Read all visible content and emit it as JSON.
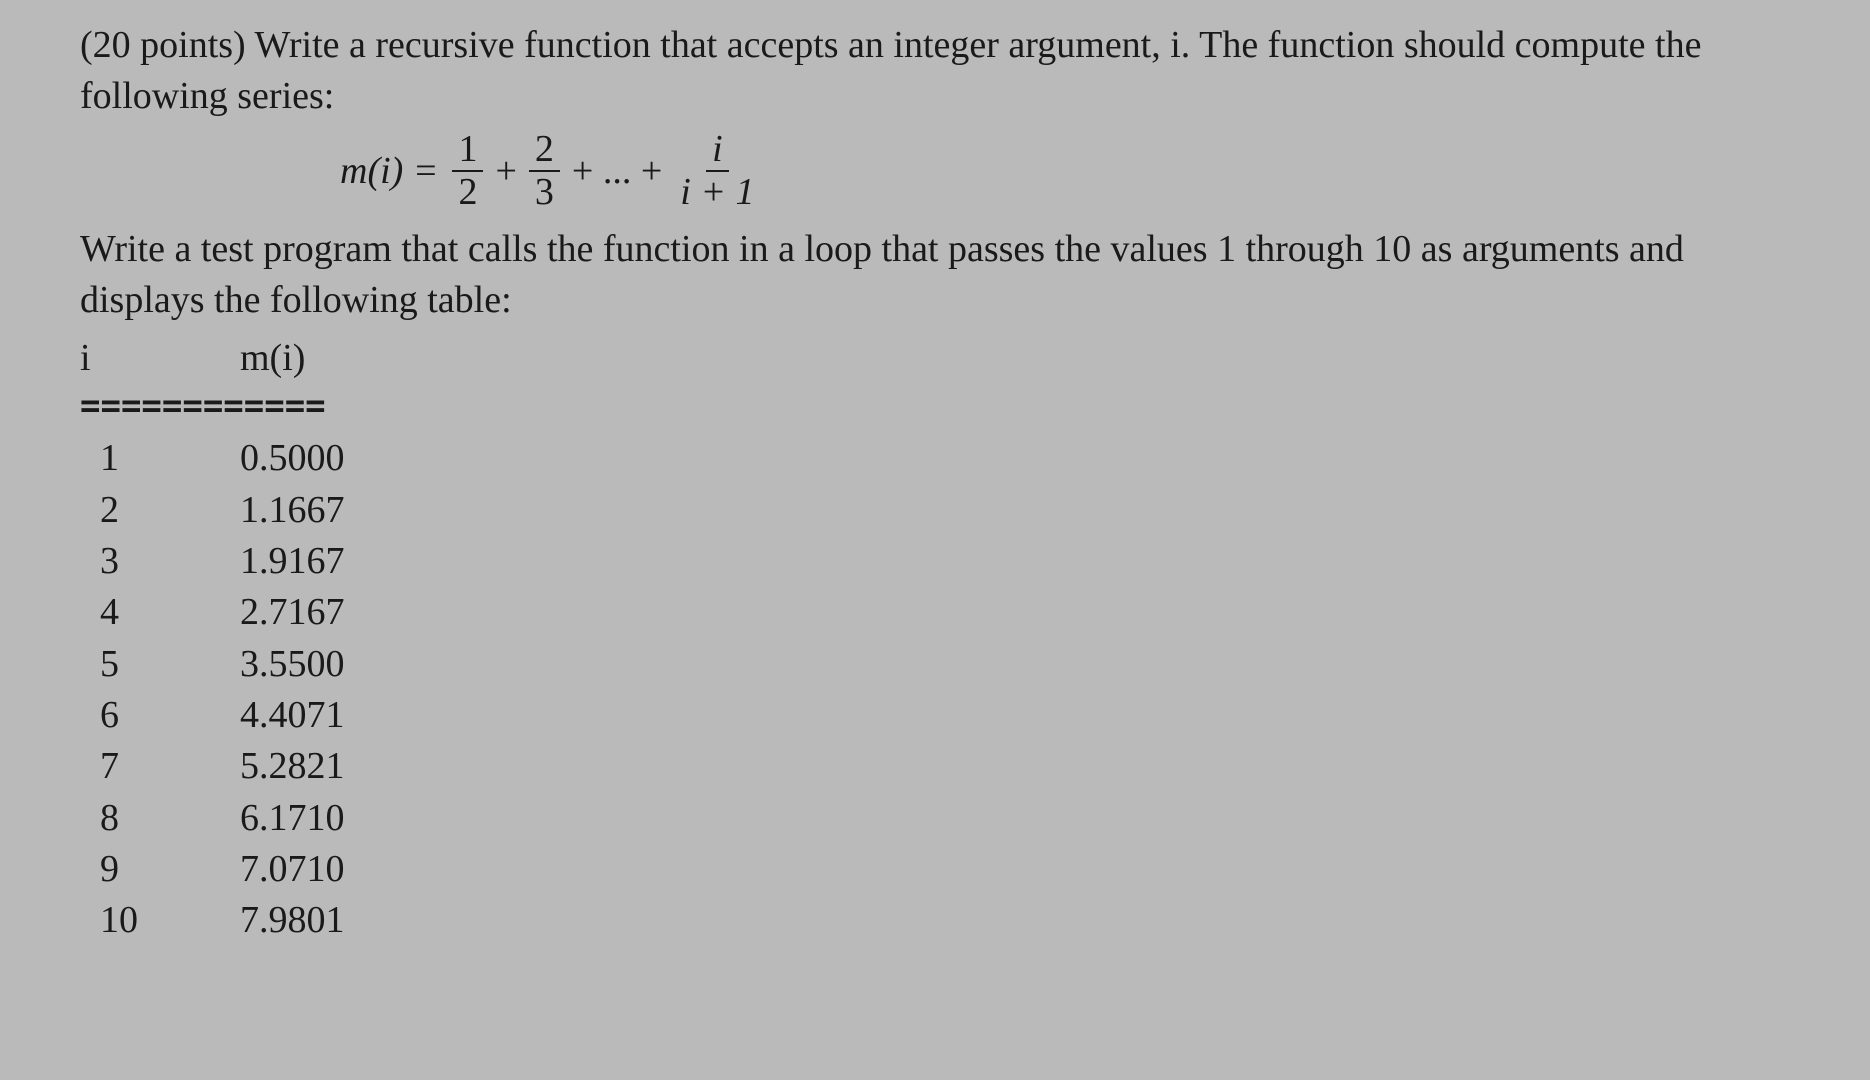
{
  "question": {
    "intro": "(20 points) Write a recursive function that accepts an integer argument, i. The function should compute the following series:",
    "formula": {
      "lhs": "m(i) =",
      "frac1_num": "1",
      "frac1_den": "2",
      "plus1": "+",
      "frac2_num": "2",
      "frac2_den": "3",
      "plus2": "+ ... +",
      "frac3_num": "i",
      "frac3_den": "i + 1"
    },
    "instruction": "Write a test program that calls the function in a loop that passes the values 1 through 10 as arguments and displays the following table:",
    "header_i": "i",
    "header_m": "m(i)",
    "divider": "============",
    "rows": [
      {
        "i": "1",
        "m": "0.5000"
      },
      {
        "i": "2",
        "m": "1.1667"
      },
      {
        "i": "3",
        "m": "1.9167"
      },
      {
        "i": "4",
        "m": "2.7167"
      },
      {
        "i": "5",
        "m": "3.5500"
      },
      {
        "i": "6",
        "m": "4.4071"
      },
      {
        "i": "7",
        "m": "5.2821"
      },
      {
        "i": "8",
        "m": "6.1710"
      },
      {
        "i": "9",
        "m": "7.0710"
      },
      {
        "i": "10",
        "m": "7.9801"
      }
    ]
  },
  "chart_data": {
    "type": "table",
    "title": "m(i) series values",
    "columns": [
      "i",
      "m(i)"
    ],
    "rows": [
      [
        1,
        0.5
      ],
      [
        2,
        1.1667
      ],
      [
        3,
        1.9167
      ],
      [
        4,
        2.7167
      ],
      [
        5,
        3.55
      ],
      [
        6,
        4.4071
      ],
      [
        7,
        5.2821
      ],
      [
        8,
        6.171
      ],
      [
        9,
        7.071
      ],
      [
        10,
        7.9801
      ]
    ]
  }
}
